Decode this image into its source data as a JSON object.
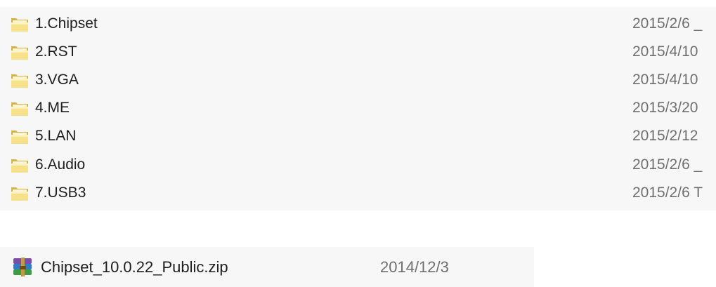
{
  "folders": [
    {
      "name": "1.Chipset",
      "date": "2015/2/6 _"
    },
    {
      "name": "2.RST",
      "date": "2015/4/10"
    },
    {
      "name": "3.VGA",
      "date": "2015/4/10"
    },
    {
      "name": "4.ME",
      "date": "2015/3/20"
    },
    {
      "name": "5.LAN",
      "date": "2015/2/12"
    },
    {
      "name": "6.Audio",
      "date": "2015/2/6 _"
    },
    {
      "name": "7.USB3",
      "date": "2015/2/6 T"
    }
  ],
  "zip_file": {
    "name": "Chipset_10.0.22_Public.zip",
    "date": "2014/12/3"
  },
  "icons": {
    "folder": "folder-icon",
    "archive": "winrar-archive-icon"
  },
  "colors": {
    "folder_light": "#f6e08a",
    "folder_dark": "#d7b14b",
    "date_text": "#6f6f6f",
    "panel_bg": "#f7f7f7"
  }
}
